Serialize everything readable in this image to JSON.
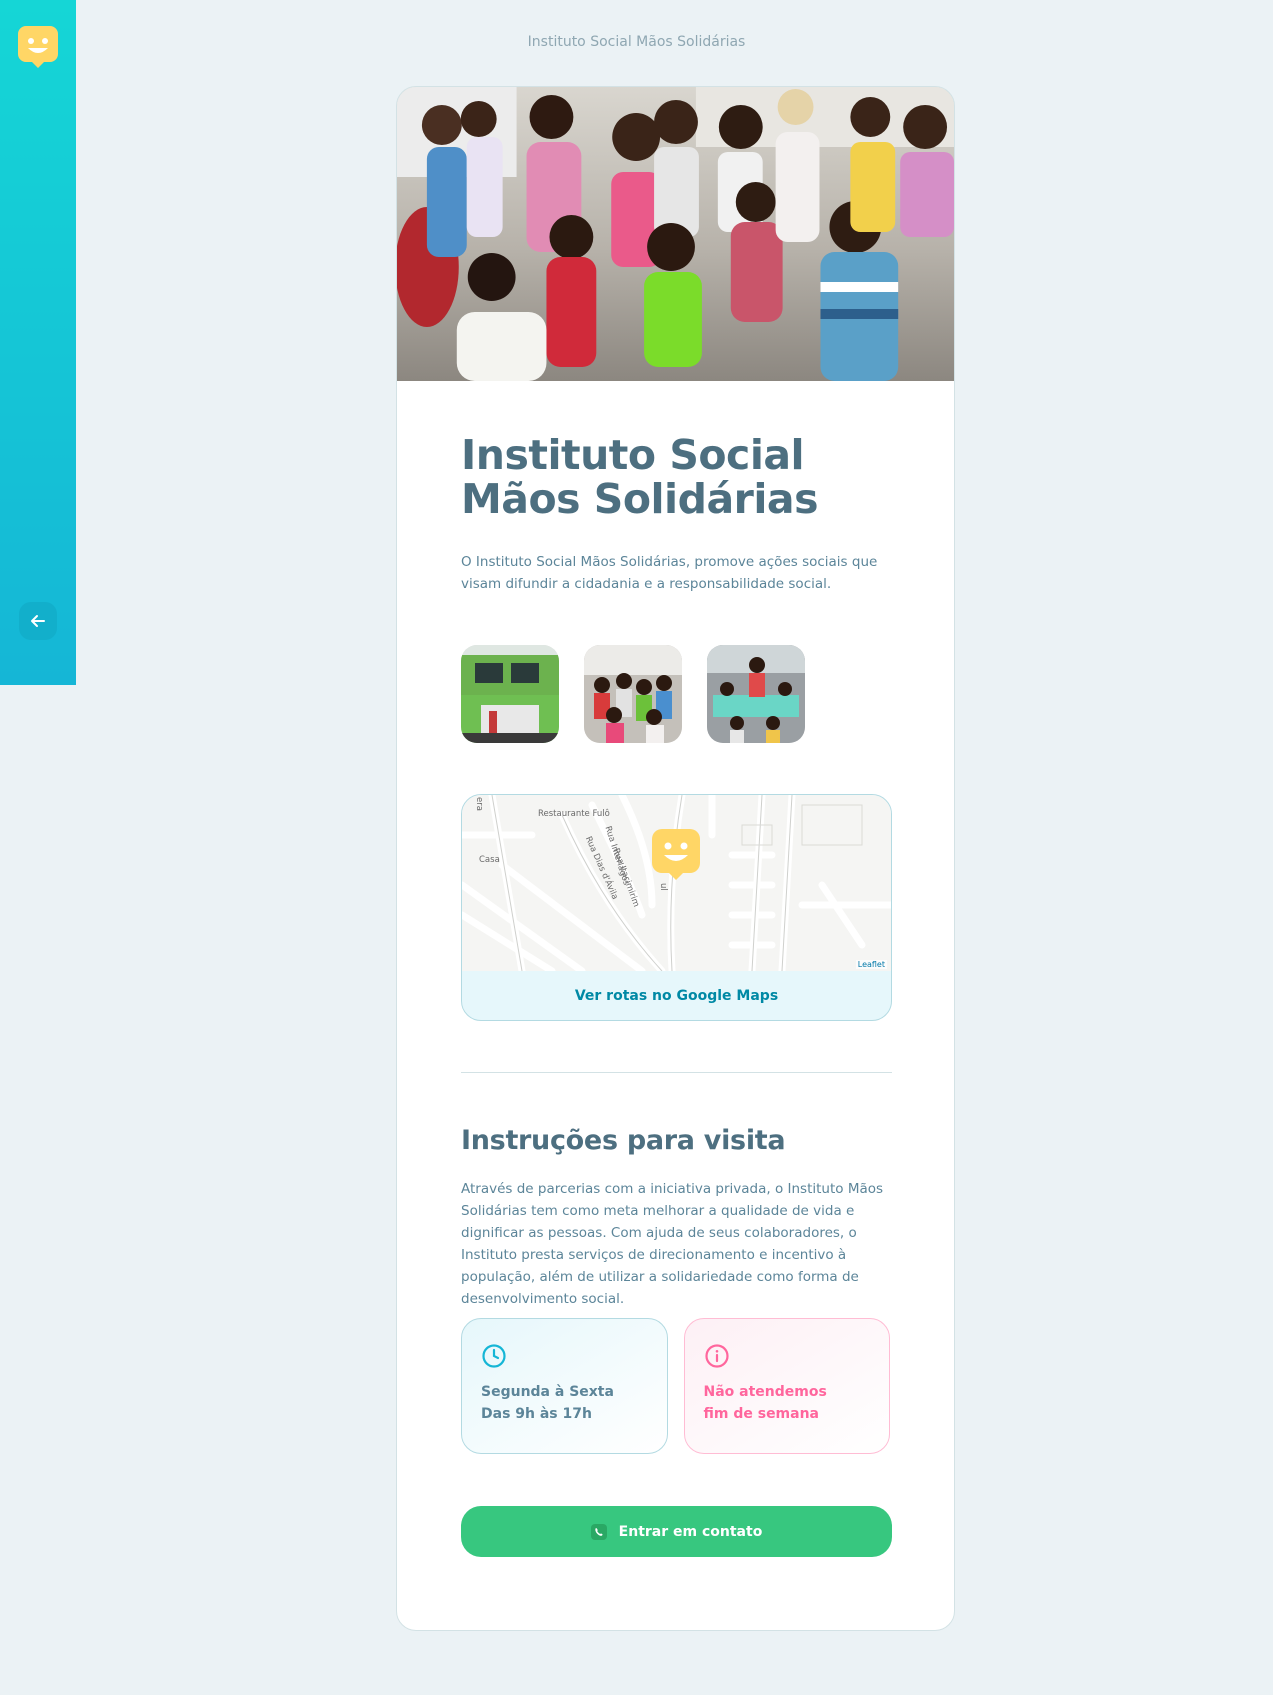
{
  "sidebar": {
    "logo_icon": "happy-marker-icon",
    "back_icon": "arrow-left-icon"
  },
  "header": {
    "label": "Instituto Social Mãos Solidárias"
  },
  "orphanage": {
    "name": "Instituto Social Mãos Solidárias",
    "about": "O Instituto Social Mãos Solidárias, promove ações sociais que visam difundir a cidadania e a responsabilidade social.",
    "images": [
      "building-photo",
      "children-group-photo",
      "classroom-photo"
    ],
    "map": {
      "labels": {
        "restaurant": "Restaurante Fulô",
        "casa": "Casa",
        "street1": "Rua Interlagos",
        "street2": "Rua Itacimirim",
        "street3": "Rua Dias d'Ávila",
        "edge": "era",
        "partial": "ul"
      },
      "attribution": "Leaflet",
      "link_label": "Ver rotas no Google Maps"
    },
    "instructions_title": "Instruções para visita",
    "instructions": "Através de parcerias com a iniciativa privada, o Instituto Mãos Solidárias tem como meta melhorar a qualidade de vida e dignificar as pessoas. Com ajuda de seus colaboradores, o Instituto presta serviços de direcionamento e incentivo à população, além de utilizar a solidariedade como forma de desenvolvimento social.",
    "hours": {
      "icon": "clock-icon",
      "line1": "Segunda à Sexta",
      "line2": "Das 9h às 17h"
    },
    "weekend": {
      "icon": "info-icon",
      "line1": "Não atendemos",
      "line2": "fim de semana"
    },
    "contact_label": "Entrar em contato"
  },
  "colors": {
    "primary": "#15c3d6",
    "title": "#4d6f80",
    "text": "#5c8599",
    "pink": "#ff669d",
    "green": "#37c77f",
    "marker": "#ffd666"
  }
}
